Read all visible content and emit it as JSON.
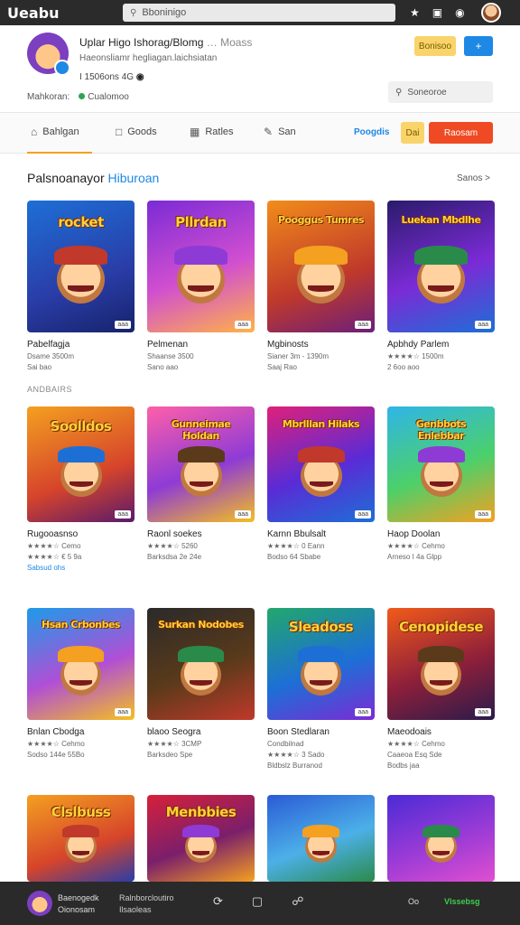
{
  "app": {
    "logo": "Ueabu"
  },
  "topbar": {
    "url": "Bboninigo"
  },
  "profile": {
    "title": "Uplar Higo Ishorag/Blomg",
    "title_sub": "… Moass",
    "description": "Haeonsliamr hegliagan.laichsiatan",
    "stats_a": "I 1506ons 4G",
    "stats_b": "◉",
    "meta_left": "Mahkoran:",
    "meta_right": "Cualomoo",
    "follow_label": "Bonisoo",
    "plus_label": "+",
    "search_placeholder": "Soneoroe"
  },
  "tabs": [
    {
      "label": "Bahlgan",
      "icon": "home-icon"
    },
    {
      "label": "Goods",
      "icon": "chat-icon"
    },
    {
      "label": "Ratles",
      "icon": "grid-icon"
    },
    {
      "label": "San",
      "icon": "tool-icon"
    }
  ],
  "tabbar": {
    "link": "Poogdis",
    "star_btn": "Dai",
    "red_btn": "Raosam"
  },
  "section": {
    "title_a": "Palsnoanayor ",
    "title_b": "Hiburoan",
    "see_all": "Sanos >",
    "sub_label": "ANDBAIRS"
  },
  "games": [
    {
      "title": "Pabelfagja",
      "line1": "Dsame 3500m",
      "line2": "Sai bao",
      "badge": "aaa",
      "art": "rocket"
    },
    {
      "title": "Pelmenan",
      "line1": "Shaanse 3500",
      "line2": "Sano aao",
      "badge": "aaa",
      "art": "Pllrdan"
    },
    {
      "title": "Mgbinosts",
      "line1": "Sianer 3m - 1390m",
      "line2": "Saaj Rao",
      "badge": "aaa",
      "art": "Pooggus Tumres"
    },
    {
      "title": "Apbhdy Parlem",
      "line1": "★★★★☆ 1500m",
      "line2": "2 6oo aoo",
      "badge": "aaa",
      "art": "Luekan Mbdlhe"
    },
    {
      "title": "Rugooasnso",
      "line1": "★★★★☆ Cemo",
      "line2": "★★★★☆ € 5 9a",
      "link": "Sabsud ohs",
      "badge": "aaa",
      "art": "Soolldos"
    },
    {
      "title": "Raonl soekes",
      "line1": "★★★★☆ 5260",
      "line2": "Barksdsa 2e 24e",
      "badge": "aaa",
      "art": "Gunneimae Holdan"
    },
    {
      "title": "Karnn Bbulsalt",
      "line1": "★★★★☆ 0 Eann",
      "line2": "Bodso 64 Sbabe",
      "badge": "aaa",
      "art": "Mbrlllan Hilaks"
    },
    {
      "title": "Haop Doolan",
      "line1": "★★★★☆ Cehmo",
      "line2": "Arneso I 4a Glpp",
      "badge": "aaa",
      "art": "Genbbots Enlebbar"
    },
    {
      "title": "Bnlan Cbodga",
      "line1": "★★★★☆ Cehmo",
      "line2": "Sodso 144e 55Bo",
      "badge": "aaa",
      "art": "Hsan Crbonbes"
    },
    {
      "title": "blaoo Seogra",
      "line1": "★★★★☆ 3CMP",
      "line2": "Barksdeo Spe",
      "badge": "",
      "art": "Surkan Nodobes"
    },
    {
      "title": "Boon Stedlaran",
      "line1": "Condbilnad",
      "line2": "★★★★☆ 3 Sado",
      "line3": "Bldbslz Burranod",
      "badge": "aaa",
      "art": "Sleadoss"
    },
    {
      "title": "Maeodoais",
      "line1": "★★★★☆ Cehmo",
      "line2": "Caaeoa Esq Sde",
      "line3": "Bodbs jaa",
      "badge": "aaa",
      "art": "Cenopidese"
    },
    {
      "title": "",
      "line1": "",
      "line2": "",
      "badge": "",
      "art": "Clslbuss"
    },
    {
      "title": "",
      "line1": "",
      "line2": "",
      "badge": "",
      "art": "Menbbies"
    },
    {
      "title": "",
      "line1": "",
      "line2": "",
      "badge": "",
      "art": ""
    },
    {
      "title": "",
      "line1": "",
      "line2": "",
      "badge": "",
      "art": ""
    }
  ],
  "bottombar": {
    "name": "Baenogedk",
    "sub": "Oionosam",
    "mid_a": "Ralnborcloutiro",
    "mid_b": "Ilsaoleas",
    "right_a": "Oo",
    "right_b": "Vlssebsg"
  },
  "colors": {
    "accent": "#1e88e5",
    "tab_underline": "#f4a020",
    "red_button": "#ef4a23",
    "follow_button": "#f9d46a"
  }
}
